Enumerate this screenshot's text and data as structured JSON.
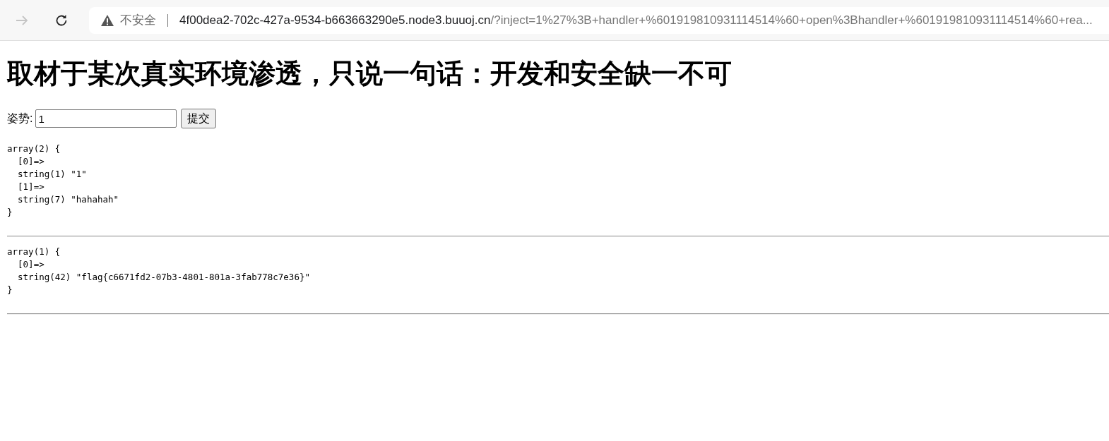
{
  "browser": {
    "forward_disabled": true,
    "security_label": "不安全",
    "url_host": "4f00dea2-702c-427a-9534-b663663290e5.node3.buuoj.cn",
    "url_path": "/?inject=1%27%3B+handler+%601919810931114514%60+open%3Bhandler+%601919810931114514%60+rea..."
  },
  "page": {
    "heading": "取材于某次真实环境渗透，只说一句话：开发和安全缺一不可",
    "form": {
      "label": "姿势:",
      "value": "1",
      "button": "提交"
    },
    "outputs": [
      "array(2) {\n  [0]=>\n  string(1) \"1\"\n  [1]=>\n  string(7) \"hahahah\"\n}\n",
      "array(1) {\n  [0]=>\n  string(42) \"flag{c6671fd2-07b3-4801-801a-3fab778c7e36}\"\n}\n"
    ]
  }
}
